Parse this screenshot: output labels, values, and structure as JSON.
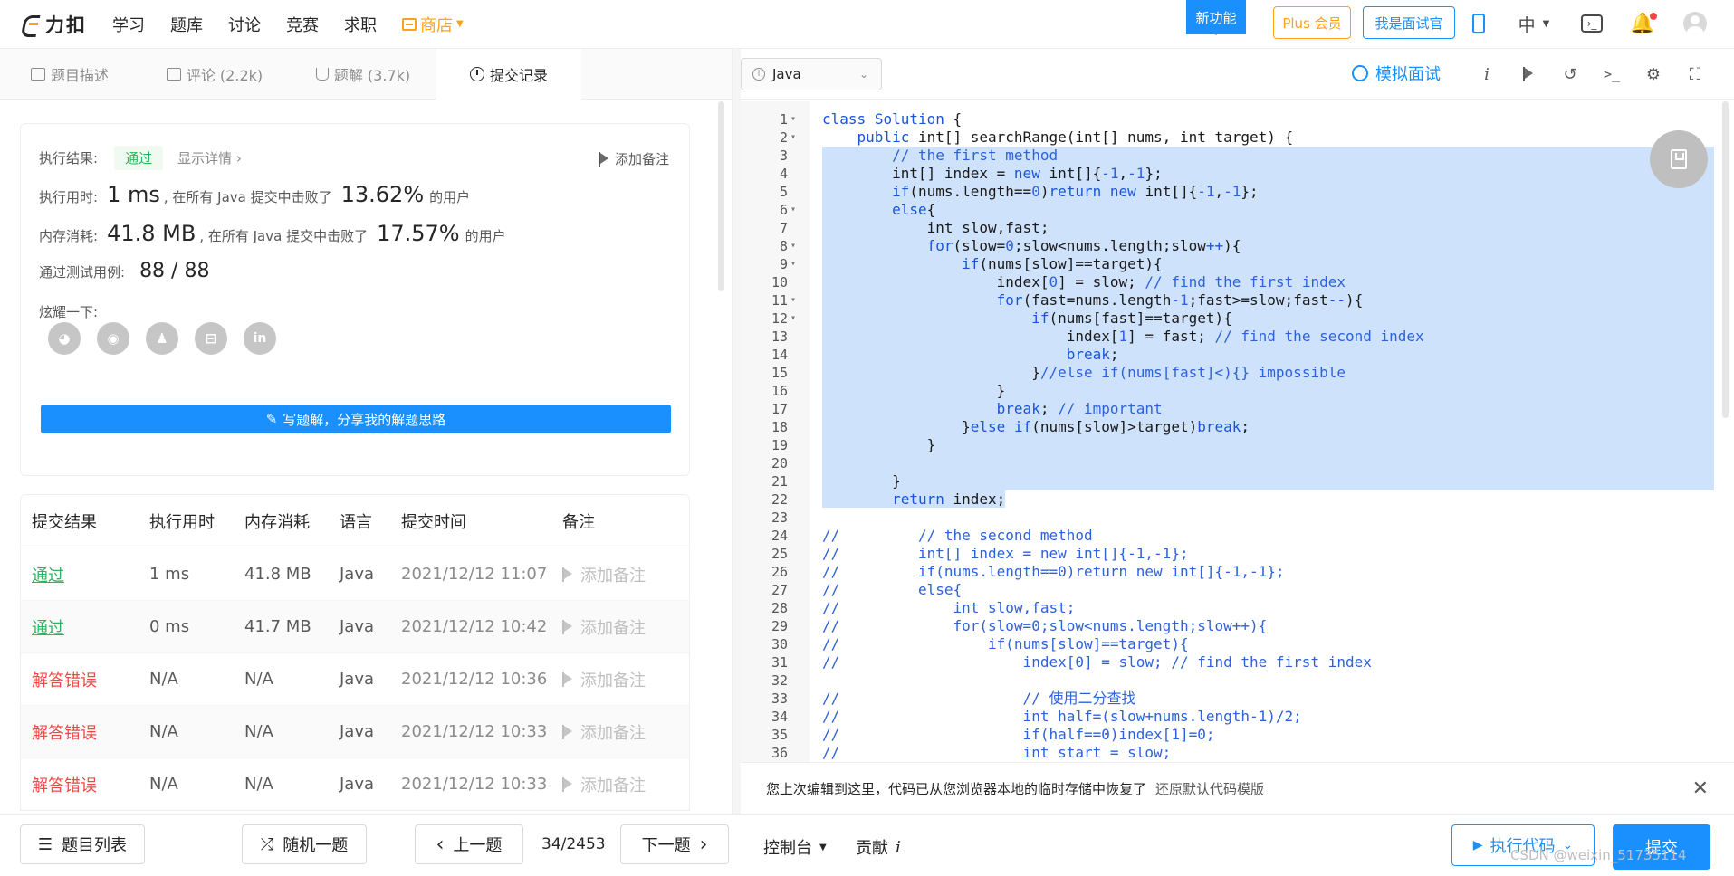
{
  "topnav": {
    "logo": "力扣",
    "links": [
      "学习",
      "题库",
      "讨论",
      "竞赛",
      "求职"
    ],
    "store": "商店",
    "new_feature": "新功能",
    "plus": "Plus 会员",
    "interviewer": "我是面试官",
    "lang": "中"
  },
  "tabs": [
    {
      "label": "题目描述"
    },
    {
      "label": "评论 (2.2k)"
    },
    {
      "label": "题解 (3.7k)"
    },
    {
      "label": "提交记录"
    }
  ],
  "result": {
    "exec_result_label": "执行结果:",
    "status": "通过",
    "show_detail": "显示详情",
    "add_note": "添加备注",
    "time_label": "执行用时:",
    "time_value": "1 ms",
    "time_text": ", 在所有 Java 提交中击败了",
    "time_pct": "13.62%",
    "users": "的用户",
    "mem_label": "内存消耗:",
    "mem_value": "41.8 MB",
    "mem_text": ", 在所有 Java 提交中击败了",
    "mem_pct": "17.57%",
    "cases_label": "通过测试用例:",
    "cases_value": "88  /  88",
    "share_label": "炫耀一下:",
    "write_solution": "写题解，分享我的解题思路"
  },
  "table": {
    "headers": [
      "提交结果",
      "执行用时",
      "内存消耗",
      "语言",
      "提交时间",
      "备注"
    ],
    "rows": [
      {
        "status": "通过",
        "time": "1 ms",
        "mem": "41.8 MB",
        "lang": "Java",
        "date": "2021/12/12 11:07",
        "note": "添加备注"
      },
      {
        "status": "通过",
        "time": "0 ms",
        "mem": "41.7 MB",
        "lang": "Java",
        "date": "2021/12/12 10:42",
        "note": "添加备注"
      },
      {
        "status": "解答错误",
        "time": "N/A",
        "mem": "N/A",
        "lang": "Java",
        "date": "2021/12/12 10:36",
        "note": "添加备注"
      },
      {
        "status": "解答错误",
        "time": "N/A",
        "mem": "N/A",
        "lang": "Java",
        "date": "2021/12/12 10:33",
        "note": "添加备注"
      },
      {
        "status": "解答错误",
        "time": "N/A",
        "mem": "N/A",
        "lang": "Java",
        "date": "2021/12/12 10:33",
        "note": "添加备注"
      }
    ]
  },
  "editor": {
    "language": "Java",
    "mock_interview": "模拟面试"
  },
  "notice": {
    "text": "您上次编辑到这里，代码已从您浏览器本地的临时存储中恢复了",
    "restore": "还原默认代码模版"
  },
  "bottom": {
    "problem_list": "题目列表",
    "random": "随机一题",
    "prev": "上一题",
    "page": "34/2453",
    "next": "下一题",
    "console": "控制台",
    "contribute": "贡献",
    "run": "执行代码",
    "submit": "提交",
    "watermark": "CSDN @weixin_51735114"
  },
  "colors": {
    "accent": "#1a90ff",
    "pass": "#2db55d",
    "error": "#ef4743",
    "store": "#ffa116"
  }
}
